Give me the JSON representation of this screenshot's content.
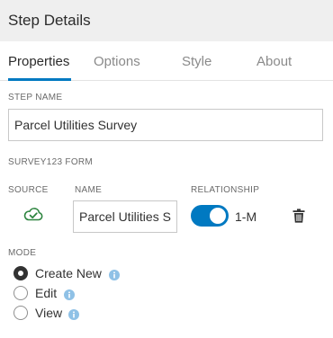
{
  "header": {
    "title": "Step Details"
  },
  "tabs": [
    {
      "label": "Properties",
      "active": true
    },
    {
      "label": "Options",
      "active": false
    },
    {
      "label": "Style",
      "active": false
    },
    {
      "label": "About",
      "active": false
    }
  ],
  "step_name": {
    "label": "STEP NAME",
    "value": "Parcel Utilities Survey"
  },
  "survey_form": {
    "section_label": "SURVEY123 FORM",
    "source_label": "SOURCE",
    "source_icon": "survey123-icon",
    "name_label": "NAME",
    "name_value": "Parcel Utilities Survey",
    "relationship_label": "RELATIONSHIP",
    "relationship_toggle_on": true,
    "relationship_value": "1-M",
    "delete_icon": "trash-icon"
  },
  "mode": {
    "label": "MODE",
    "options": [
      {
        "label": "Create New",
        "checked": true
      },
      {
        "label": "Edit",
        "checked": false
      },
      {
        "label": "View",
        "checked": false
      }
    ]
  },
  "colors": {
    "accent": "#0079c1",
    "source_icon": "#2e8540",
    "info_icon": "#8fc1e6",
    "header_bg": "#efefef"
  }
}
